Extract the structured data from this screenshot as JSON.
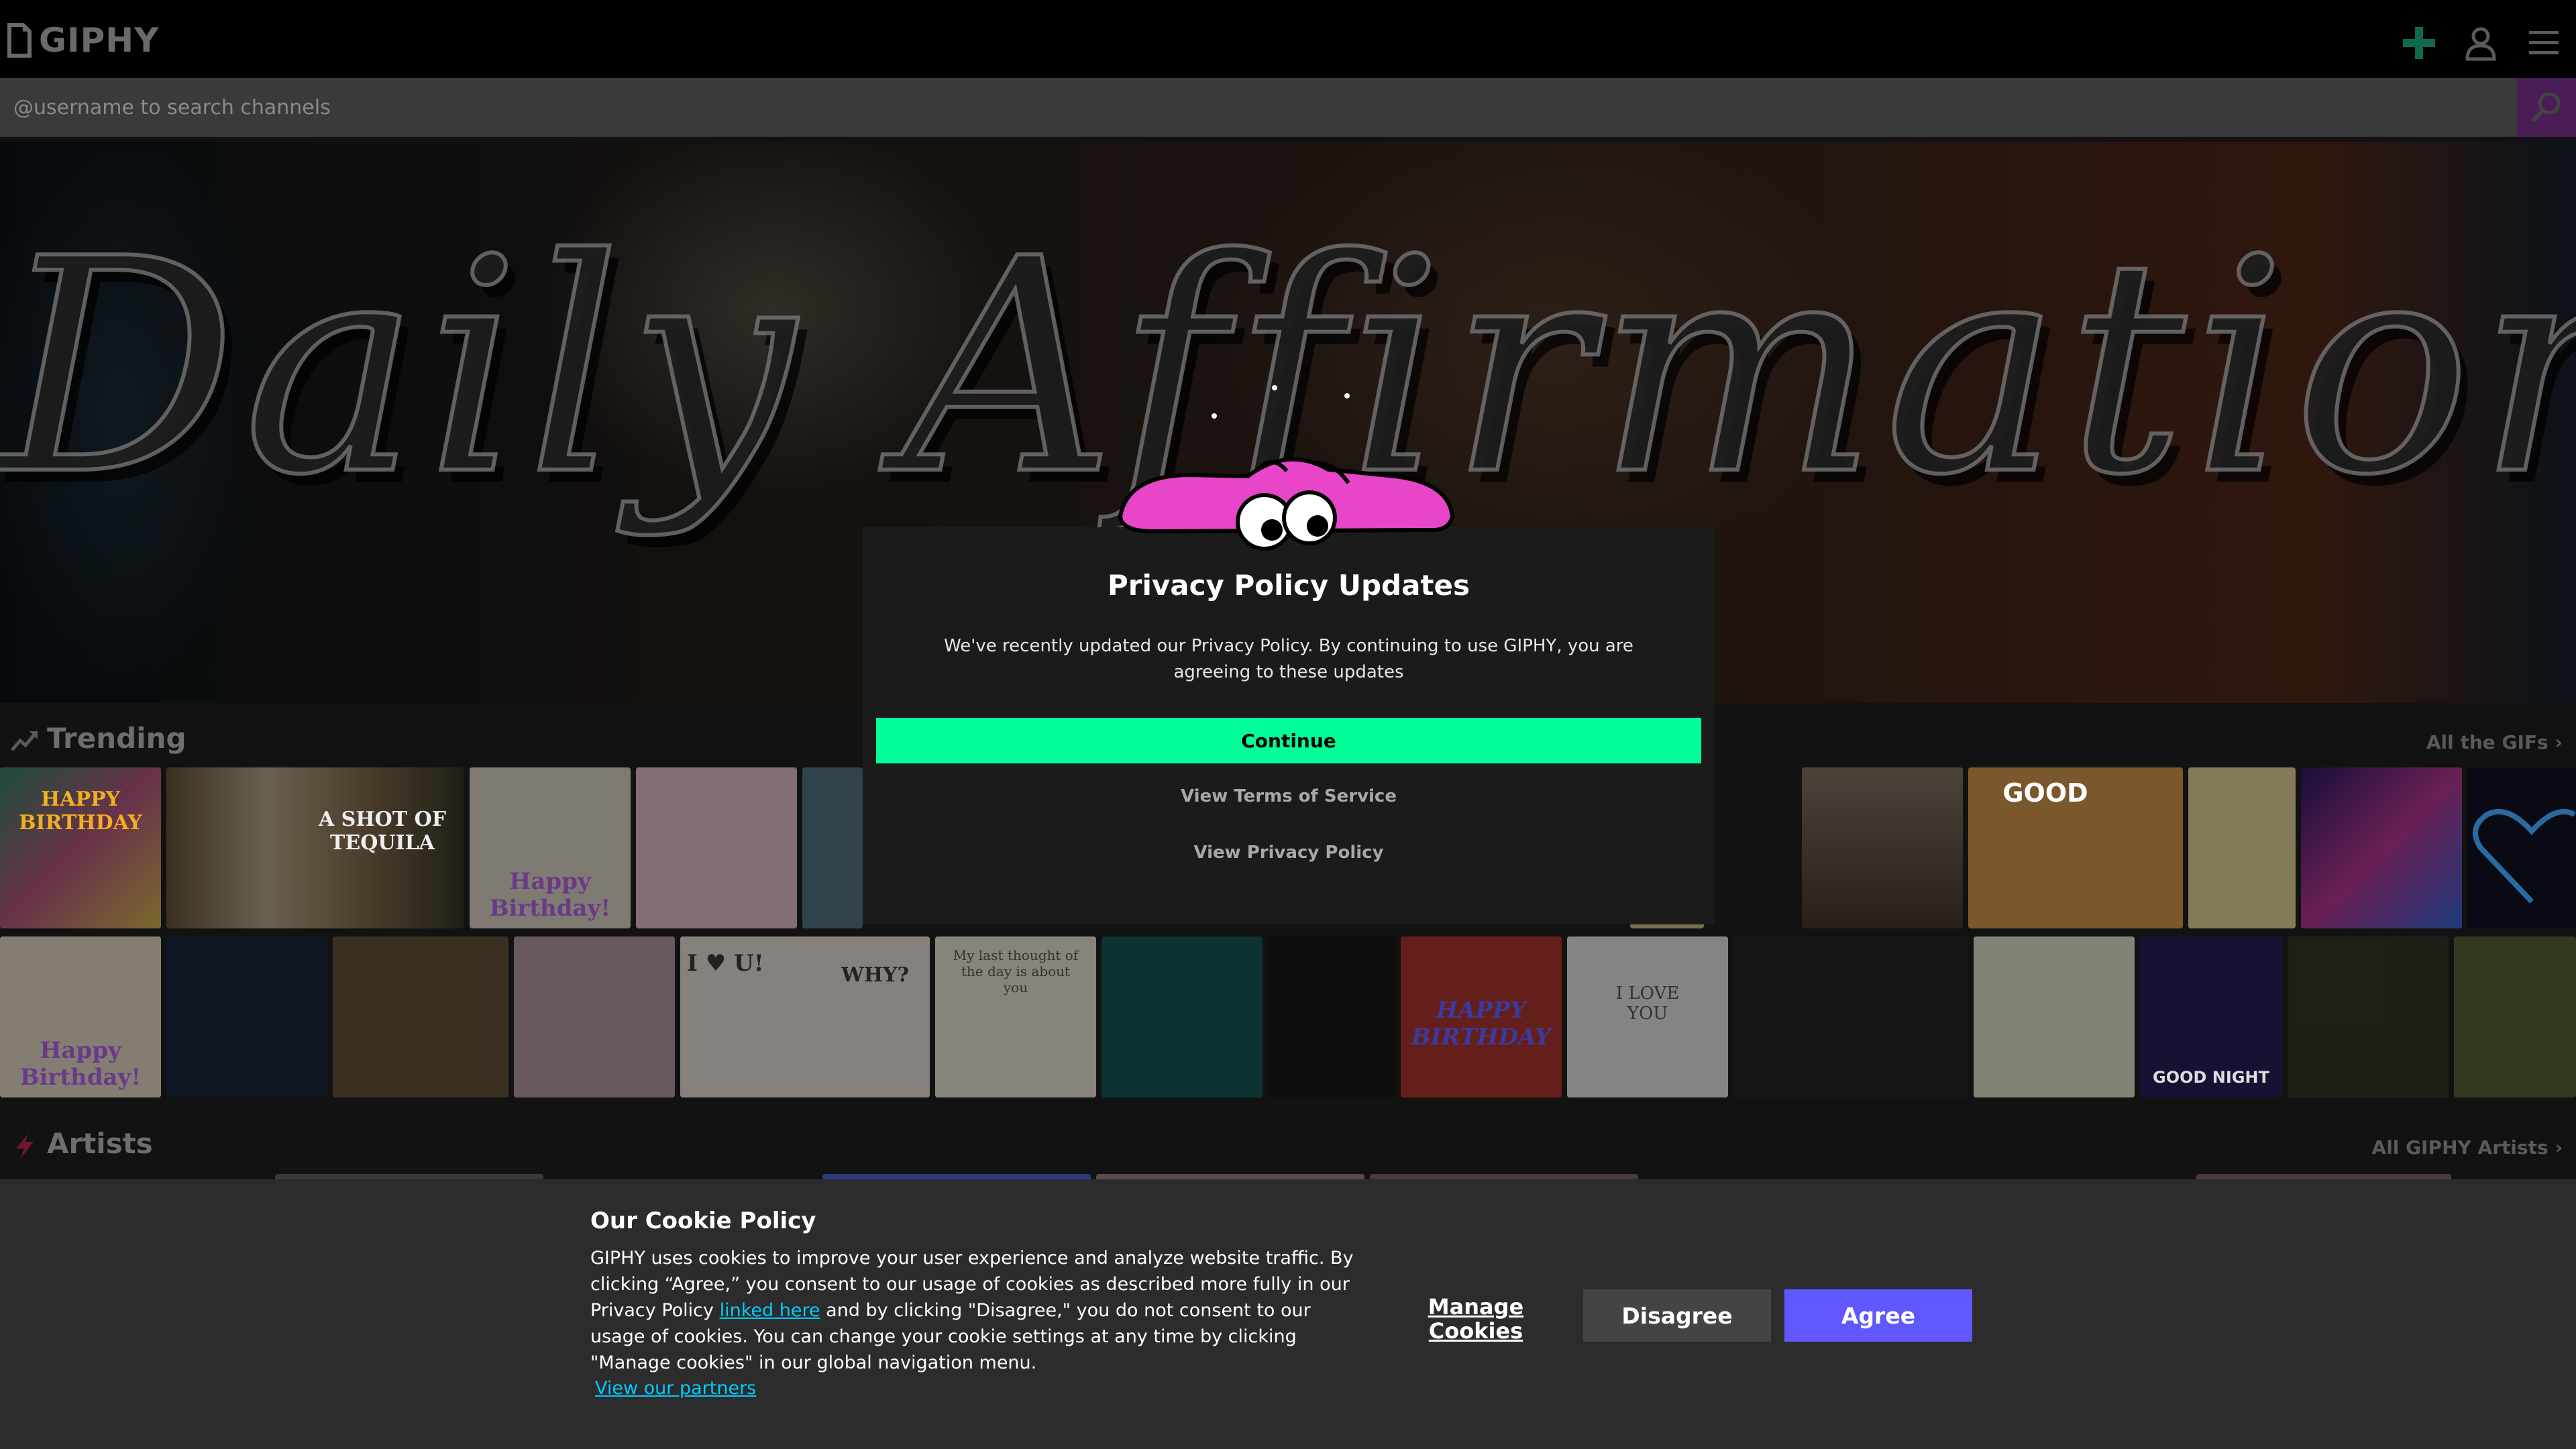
{
  "header": {
    "logo_text": "GIPHY",
    "upload_icon": "plus-icon",
    "user_icon": "user-icon",
    "menu_icon": "hamburger-menu-icon"
  },
  "search": {
    "placeholder": "@username to search channels",
    "button_icon": "search-icon"
  },
  "hero": {
    "title": "Daily Affirmations"
  },
  "trending": {
    "title": "Trending",
    "link": "All the GIFs",
    "icon": "trending-arrow-icon",
    "row1_captions": [
      "HAPPY BIRTHDAY",
      "A SHOT OF TEQUILA",
      "Happy Birthday!",
      "",
      "",
      "",
      "",
      "",
      "GOOD",
      "",
      ""
    ],
    "row2_captions": [
      "Happy Birthday!",
      "",
      "",
      "",
      "I ♥ U!",
      "WHY?",
      "My last thought of the day is about you",
      "",
      "",
      "HAPPY BIRTHDAY",
      "I LOVE YOU",
      "",
      "",
      "GOOD NIGHT",
      ""
    ]
  },
  "artists": {
    "title": "Artists",
    "link": "All GIPHY Artists",
    "icon": "lightning-icon"
  },
  "privacy_modal": {
    "title": "Privacy Policy Updates",
    "body": "We've recently updated our Privacy Policy. By continuing to use GIPHY, you are agreeing to these updates",
    "continue_label": "Continue",
    "terms_link": "View Terms of Service",
    "privacy_link": "View Privacy Policy",
    "mascot_icon": "peeking-mascot-icon",
    "accent_color": "#00ff99"
  },
  "cookie_banner": {
    "title": "Our Cookie Policy",
    "body_part1": "GIPHY uses cookies to improve your user experience and analyze website traffic. By clicking “Agree,” you consent to our usage of cookies as described more fully in our Privacy Policy ",
    "body_link": "linked here",
    "body_part2": " and by clicking \"Disagree,\" you do not consent to our usage of cookies. You can change your cookie settings at any time by clicking \"Manage cookies\" in our global navigation menu.",
    "partners_link": "View our partners",
    "manage_label": "Manage Cookies",
    "disagree_label": "Disagree",
    "agree_label": "Agree",
    "agree_color": "#6157ff",
    "link_color": "#00ccff"
  }
}
